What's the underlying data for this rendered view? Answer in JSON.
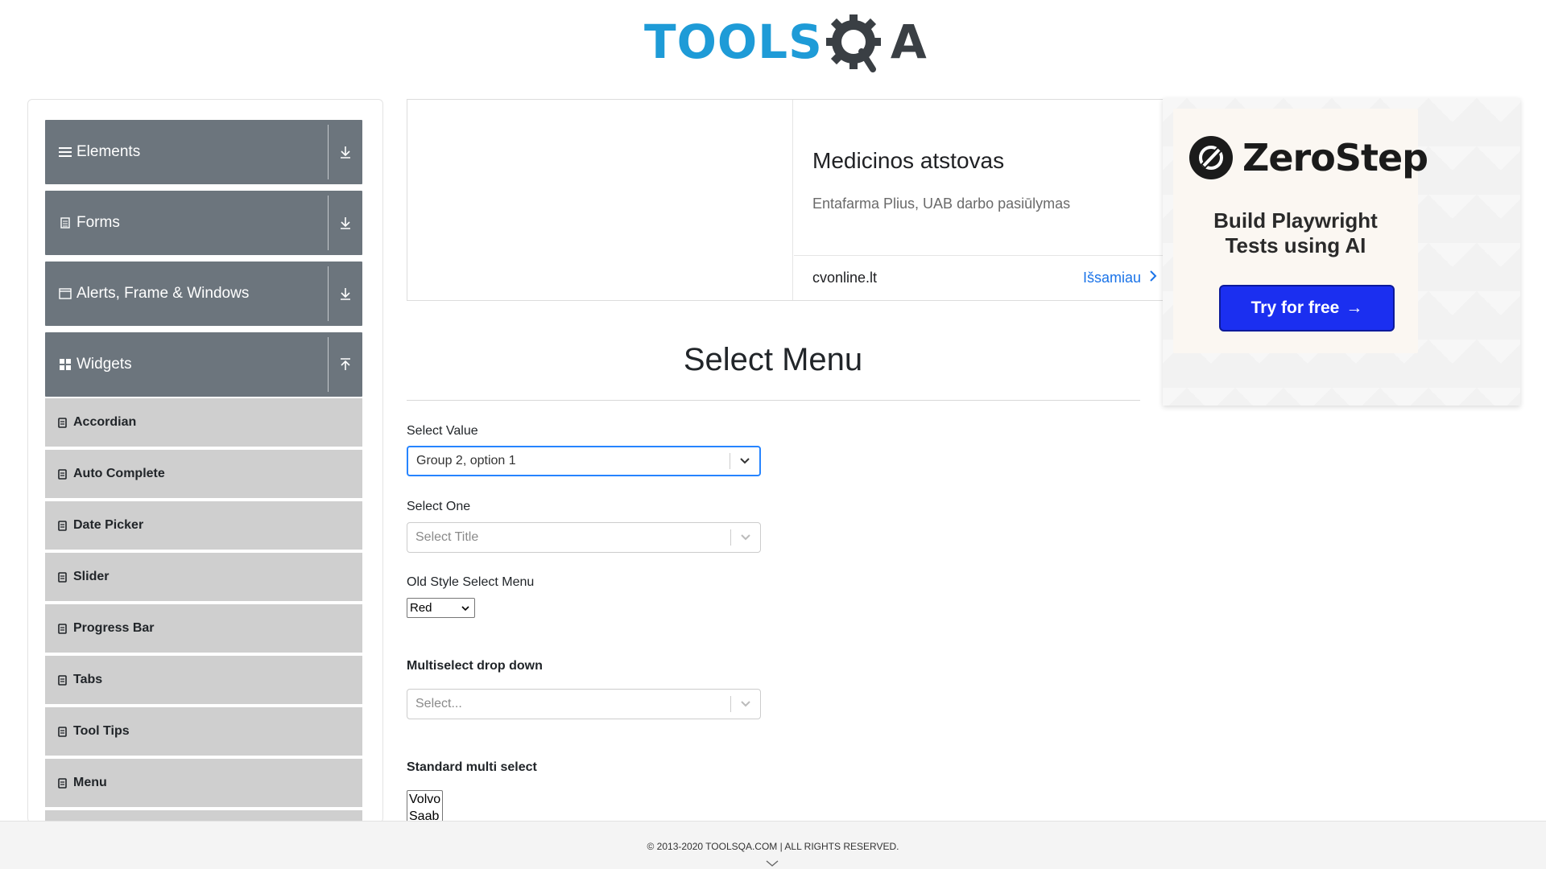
{
  "logo": {
    "part1": "TOOLS",
    "part2": "A",
    "alt": "ToolsQA"
  },
  "sidebar": {
    "groups": [
      {
        "label": "Elements",
        "icon": "hamburger-icon",
        "state": "collapsed"
      },
      {
        "label": "Forms",
        "icon": "document-icon",
        "state": "collapsed"
      },
      {
        "label": "Alerts, Frame & Windows",
        "icon": "window-icon",
        "state": "collapsed"
      },
      {
        "label": "Widgets",
        "icon": "widgets-grid-icon",
        "state": "expanded"
      }
    ],
    "items": [
      {
        "label": "Accordian"
      },
      {
        "label": "Auto Complete"
      },
      {
        "label": "Date Picker"
      },
      {
        "label": "Slider"
      },
      {
        "label": "Progress Bar"
      },
      {
        "label": "Tabs"
      },
      {
        "label": "Tool Tips"
      },
      {
        "label": "Menu"
      }
    ]
  },
  "ad": {
    "title": "Medicinos atstovas",
    "subtitle": "Entafarma Plius, UAB darbo pasiūlymas",
    "domain": "cvonline.lt",
    "link": "Išsamiau"
  },
  "promo": {
    "brand": "ZeroStep",
    "headline_line1": "Build Playwright",
    "headline_line2": "Tests using AI",
    "button": "Try for free",
    "button_arrow": "→"
  },
  "main": {
    "title": "Select Menu",
    "select_value": {
      "label": "Select Value",
      "value": "Group 2, option 1"
    },
    "select_one": {
      "label": "Select One",
      "placeholder": "Select Title"
    },
    "old_style": {
      "label": "Old Style Select Menu",
      "value": "Red"
    },
    "multiselect": {
      "label": "Multiselect drop down",
      "placeholder": "Select..."
    },
    "standard_multi": {
      "label": "Standard multi select",
      "options": [
        "Volvo",
        "Saab"
      ]
    }
  },
  "footer": {
    "text": "© 2013-2020 TOOLSQA.COM | ALL RIGHTS RESERVED."
  },
  "colors": {
    "sidebar_header": "#6c757d",
    "sidebar_item": "#cfcfcf",
    "focus_blue": "#2684ff",
    "logo_blue": "#1e9bd7",
    "promo_button": "#1b2ff0",
    "ad_link": "#1a73e8"
  }
}
